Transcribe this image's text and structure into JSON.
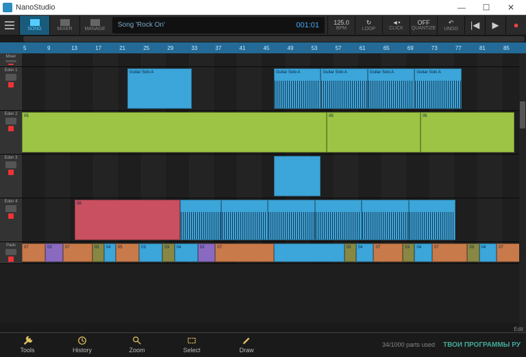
{
  "app": {
    "title": "NanoStudio"
  },
  "window": {
    "min": "—",
    "max": "☐",
    "close": "✕"
  },
  "toolbar": {
    "song": "SONG",
    "mixer": "MIXER",
    "manage": "MANAGE",
    "display": {
      "song": "Song 'Rock On'",
      "time": "001:01"
    },
    "bpm": {
      "val": "125.0",
      "label": "BPM"
    },
    "loop": {
      "val": "↻",
      "label": "LOOP"
    },
    "click": {
      "val": "◄•",
      "label": "CLICK"
    },
    "quant": {
      "val": "OFF",
      "label": "QUANTIZE"
    },
    "undo": {
      "val": "↶",
      "label": "UNDO"
    }
  },
  "ruler": [
    "5",
    "9",
    "13",
    "17",
    "21",
    "25",
    "29",
    "33",
    "37",
    "41",
    "45",
    "49",
    "53",
    "57",
    "61",
    "65",
    "69",
    "73",
    "77",
    "81",
    "85"
  ],
  "tracks": [
    {
      "name": "Mixer",
      "h": "h20"
    },
    {
      "name": "Eden 1",
      "h": "h64",
      "clips": [
        {
          "l": 18,
          "w": 11,
          "cls": "blue",
          "label": "Guitar Solo A"
        },
        {
          "l": 43,
          "w": 8,
          "cls": "blue",
          "label": "Guitar Solo A",
          "wave": true
        },
        {
          "l": 51,
          "w": 8,
          "cls": "blue",
          "label": "Guitar Solo A",
          "wave": true
        },
        {
          "l": 59,
          "w": 8,
          "cls": "blue",
          "label": "Guitar Solo A",
          "wave": true
        },
        {
          "l": 67,
          "w": 8,
          "cls": "blue",
          "label": "Guitar Solo A",
          "wave": true
        }
      ]
    },
    {
      "name": "Eden 2",
      "h": "h64",
      "clips": [
        {
          "l": 0,
          "w": 52,
          "cls": "green",
          "label": "05"
        },
        {
          "l": 52,
          "w": 16,
          "cls": "green",
          "label": "05"
        },
        {
          "l": 68,
          "w": 16,
          "cls": "green",
          "label": "05"
        }
      ]
    },
    {
      "name": "Eden 3",
      "h": "h64",
      "clips": [
        {
          "l": 43,
          "w": 8,
          "cls": "blue",
          "label": ""
        }
      ]
    },
    {
      "name": "Eden 4",
      "h": "h64",
      "clips": [
        {
          "l": 9,
          "w": 18,
          "cls": "red",
          "label": "08"
        },
        {
          "l": 27,
          "w": 7,
          "cls": "blue",
          "label": "",
          "wave": true
        },
        {
          "l": 34,
          "w": 8,
          "cls": "blue",
          "label": "",
          "wave": true
        },
        {
          "l": 42,
          "w": 8,
          "cls": "blue",
          "label": "",
          "wave": true
        },
        {
          "l": 50,
          "w": 8,
          "cls": "blue",
          "label": "",
          "wave": true
        },
        {
          "l": 58,
          "w": 8,
          "cls": "blue",
          "label": "",
          "wave": true
        },
        {
          "l": 66,
          "w": 8,
          "cls": "blue",
          "label": "",
          "wave": true
        }
      ]
    },
    {
      "name": "Pads",
      "h": "h32",
      "clips": [
        {
          "l": 0,
          "w": 4,
          "cls": "orange",
          "label": "07"
        },
        {
          "l": 4,
          "w": 3,
          "cls": "purple",
          "label": "02"
        },
        {
          "l": 7,
          "w": 5,
          "cls": "orange",
          "label": "07"
        },
        {
          "l": 12,
          "w": 2,
          "cls": "olive",
          "label": "03"
        },
        {
          "l": 14,
          "w": 2,
          "cls": "blue",
          "label": "04"
        },
        {
          "l": 16,
          "w": 4,
          "cls": "orange",
          "label": "05"
        },
        {
          "l": 20,
          "w": 4,
          "cls": "blue",
          "label": "03"
        },
        {
          "l": 24,
          "w": 2,
          "cls": "olive",
          "label": "03"
        },
        {
          "l": 26,
          "w": 4,
          "cls": "blue",
          "label": "04"
        },
        {
          "l": 30,
          "w": 3,
          "cls": "purple",
          "label": "02"
        },
        {
          "l": 33,
          "w": 10,
          "cls": "orange",
          "label": "07"
        },
        {
          "l": 43,
          "w": 12,
          "cls": "blue",
          "label": ""
        },
        {
          "l": 55,
          "w": 2,
          "cls": "olive",
          "label": "03"
        },
        {
          "l": 57,
          "w": 3,
          "cls": "blue",
          "label": "04"
        },
        {
          "l": 60,
          "w": 5,
          "cls": "orange",
          "label": "07"
        },
        {
          "l": 65,
          "w": 2,
          "cls": "olive",
          "label": "03"
        },
        {
          "l": 67,
          "w": 3,
          "cls": "blue",
          "label": "04"
        },
        {
          "l": 70,
          "w": 6,
          "cls": "orange",
          "label": "07"
        },
        {
          "l": 76,
          "w": 2,
          "cls": "olive",
          "label": "03"
        },
        {
          "l": 78,
          "w": 3,
          "cls": "blue",
          "label": "04"
        },
        {
          "l": 81,
          "w": 5,
          "cls": "orange",
          "label": "07"
        }
      ]
    }
  ],
  "bottom": {
    "tools": "Tools",
    "history": "History",
    "zoom": "Zoom",
    "select": "Select",
    "draw": "Draw",
    "status": "34/1000 parts used",
    "watermark": "ТВОИ ПРОГРАММЫ РУ",
    "edit": "Edit"
  }
}
